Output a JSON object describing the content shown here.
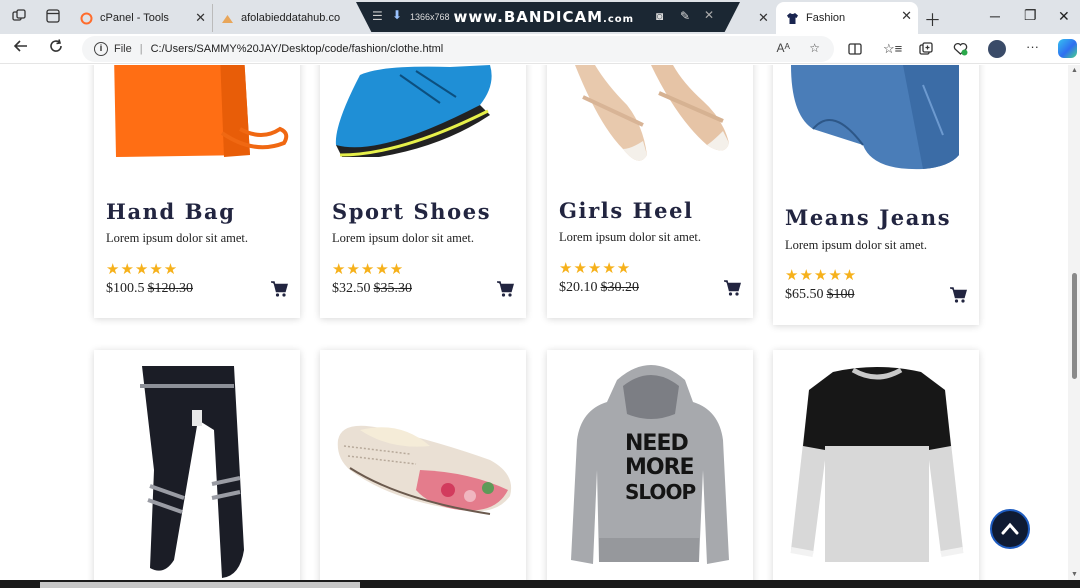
{
  "browser": {
    "tabs": [
      {
        "label": "cPanel - Tools",
        "favicon_color": "#ff6c2c"
      },
      {
        "label": "afolabieddatahub.co",
        "favicon_color": "#e8a65a"
      },
      {
        "label": "Fashion",
        "favicon_color": "#1a2550",
        "active": true
      }
    ],
    "recorder": {
      "resolution": "1366x768",
      "brand": "www.BANDICAM",
      "brand_suffix": ".com"
    },
    "address": {
      "scheme_label": "File",
      "url": "C:/Users/SAMMY%20JAY/Desktop/code/fashion/clothe.html"
    }
  },
  "products_row1": [
    {
      "name": "Hand Bag",
      "desc": "Lorem ipsum dolor sit amet.",
      "rating": 5,
      "price": "$100.5",
      "old_price": "$120.30",
      "image": "orange-handbag"
    },
    {
      "name": "Sport Shoes",
      "desc": "Lorem ipsum dolor sit amet.",
      "rating": 5,
      "price": "$32.50",
      "old_price": "$35.30",
      "image": "blue-sport-shoe"
    },
    {
      "name": "Girls Heel",
      "desc": "Lorem ipsum dolor sit amet.",
      "rating": 5,
      "price": "$20.10",
      "old_price": "$30.20",
      "image": "nude-heels"
    },
    {
      "name": "Means Jeans",
      "desc": "Lorem ipsum dolor sit amet.",
      "rating": 5,
      "price": "$65.50",
      "old_price": "$100",
      "image": "folded-jeans"
    }
  ],
  "products_row2": [
    {
      "image": "black-joggers"
    },
    {
      "image": "floral-flats"
    },
    {
      "image": "grey-hoodie",
      "print_text": [
        "NEED",
        "MORE",
        "SLOOP"
      ]
    },
    {
      "image": "black-grey-sweater"
    }
  ],
  "colors": {
    "heading": "#222540",
    "star": "#f6b11b",
    "cart": "#222540",
    "scroll_top_button": "#0f1b33"
  }
}
